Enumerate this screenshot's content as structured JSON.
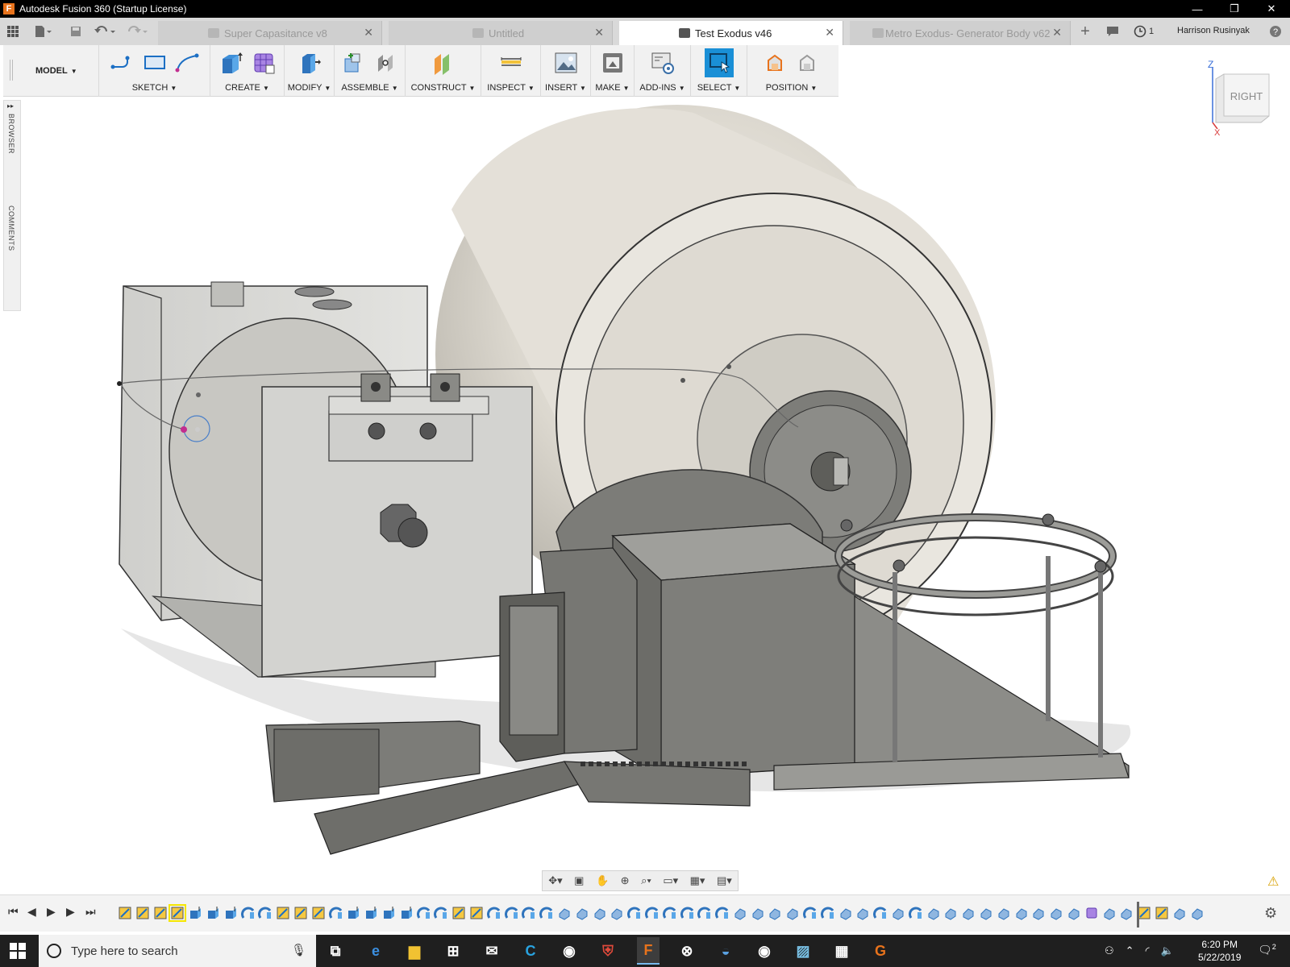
{
  "window": {
    "title": "Autodesk Fusion 360 (Startup License)",
    "app_icon_letter": "F",
    "minimize_glyph": "—",
    "restore_glyph": "❐",
    "close_glyph": "✕"
  },
  "tabs": [
    {
      "label": "Super Capasitance v8",
      "active": false
    },
    {
      "label": "Untitled",
      "active": false
    },
    {
      "label": "Test Exodus v46",
      "active": true
    },
    {
      "label": "Metro Exodus- Generator Body v62",
      "active": false
    }
  ],
  "tab_close_glyph": "✕",
  "tab_add_glyph": "+",
  "jobs_count": "1",
  "user_name": "Harrison Rusinyak",
  "help_glyph": "?",
  "toolbar": {
    "workspace": "MODEL",
    "groups": [
      {
        "label": "SKETCH"
      },
      {
        "label": "CREATE"
      },
      {
        "label": "MODIFY"
      },
      {
        "label": "ASSEMBLE"
      },
      {
        "label": "CONSTRUCT"
      },
      {
        "label": "INSPECT"
      },
      {
        "label": "INSERT"
      },
      {
        "label": "MAKE"
      },
      {
        "label": "ADD-INS"
      },
      {
        "label": "SELECT"
      },
      {
        "label": "POSITION"
      }
    ]
  },
  "viewcube": {
    "face": "RIGHT",
    "axis_z": "Z",
    "axis_x": "X"
  },
  "browser_panel": {
    "browser_label": "BROWSER",
    "comments_label": "COMMENTS",
    "expand_glyph": "▸▸"
  },
  "taskbar": {
    "search_placeholder": "Type here to search",
    "time": "6:20 PM",
    "date": "5/22/2019",
    "notification_count": "2"
  },
  "colors": {
    "fusion_orange": "#e8731c",
    "select_blue": "#1a8fd6",
    "timeline_highlight": "#f5e600",
    "taskbar": "#1f1f1f"
  }
}
